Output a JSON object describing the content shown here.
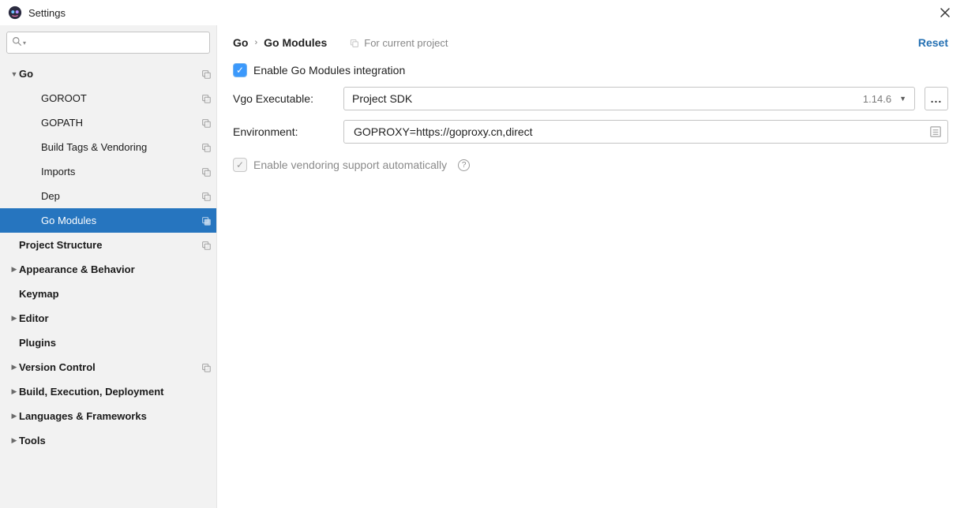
{
  "window": {
    "title": "Settings",
    "close_tooltip": "Close"
  },
  "search": {
    "placeholder": ""
  },
  "sidebar": {
    "items": [
      {
        "label": "Go",
        "indent": 0,
        "arrow": "down",
        "bold": true,
        "copy": true,
        "selected": false
      },
      {
        "label": "GOROOT",
        "indent": 1,
        "arrow": null,
        "bold": false,
        "copy": true,
        "selected": false
      },
      {
        "label": "GOPATH",
        "indent": 1,
        "arrow": null,
        "bold": false,
        "copy": true,
        "selected": false
      },
      {
        "label": "Build Tags & Vendoring",
        "indent": 1,
        "arrow": null,
        "bold": false,
        "copy": true,
        "selected": false
      },
      {
        "label": "Imports",
        "indent": 1,
        "arrow": null,
        "bold": false,
        "copy": true,
        "selected": false
      },
      {
        "label": "Dep",
        "indent": 1,
        "arrow": null,
        "bold": false,
        "copy": true,
        "selected": false
      },
      {
        "label": "Go Modules",
        "indent": 1,
        "arrow": null,
        "bold": false,
        "copy": true,
        "selected": true
      },
      {
        "label": "Project Structure",
        "indent": 0,
        "arrow": "spacer",
        "bold": true,
        "copy": true,
        "selected": false
      },
      {
        "label": "Appearance & Behavior",
        "indent": 0,
        "arrow": "right",
        "bold": true,
        "copy": false,
        "selected": false
      },
      {
        "label": "Keymap",
        "indent": 0,
        "arrow": "spacer",
        "bold": true,
        "copy": false,
        "selected": false
      },
      {
        "label": "Editor",
        "indent": 0,
        "arrow": "right",
        "bold": true,
        "copy": false,
        "selected": false
      },
      {
        "label": "Plugins",
        "indent": 0,
        "arrow": "spacer",
        "bold": true,
        "copy": false,
        "selected": false
      },
      {
        "label": "Version Control",
        "indent": 0,
        "arrow": "right",
        "bold": true,
        "copy": true,
        "selected": false
      },
      {
        "label": "Build, Execution, Deployment",
        "indent": 0,
        "arrow": "right",
        "bold": true,
        "copy": false,
        "selected": false
      },
      {
        "label": "Languages & Frameworks",
        "indent": 0,
        "arrow": "right",
        "bold": true,
        "copy": false,
        "selected": false
      },
      {
        "label": "Tools",
        "indent": 0,
        "arrow": "right",
        "bold": true,
        "copy": false,
        "selected": false
      }
    ]
  },
  "header": {
    "crumb1": "Go",
    "crumb2": "Go Modules",
    "scope": "For current project",
    "reset": "Reset"
  },
  "form": {
    "enable_label": "Enable Go Modules integration",
    "vgo_label": "Vgo Executable:",
    "vgo_selected": "Project SDK",
    "vgo_version": "1.14.6",
    "ellipsis": "...",
    "env_label": "Environment:",
    "env_value": "GOPROXY=https://goproxy.cn,direct",
    "vendoring_label": "Enable vendoring support automatically"
  }
}
